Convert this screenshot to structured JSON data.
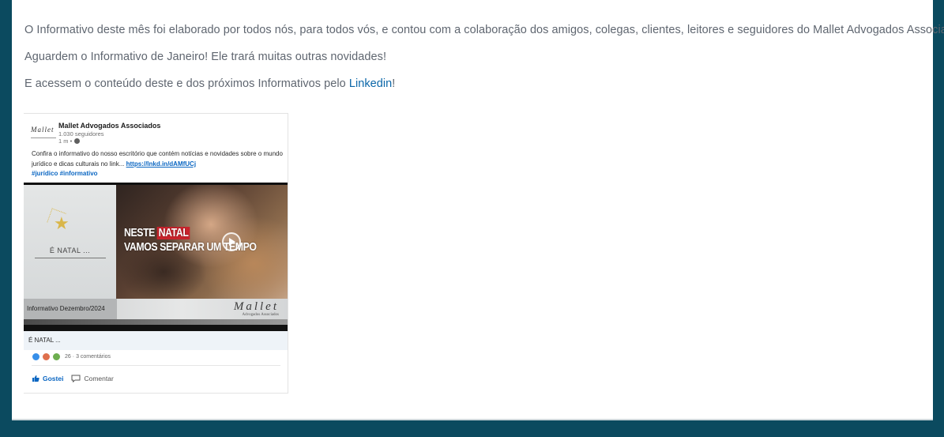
{
  "newsletter": {
    "paragraph_1": "O Informativo deste mês foi elaborado por todos nós, para todos vós, e contou com a colaboração dos amigos, colegas, clientes, leitores e seguidores do Mallet Advogados Associados!",
    "paragraph_2": "Aguardem o Informativo de Janeiro! Ele trará muitas outras novidades!",
    "paragraph_3_prefix": "E acessem o conteúdo deste e dos próximos Informativos pelo ",
    "paragraph_3_link": "Linkedin",
    "paragraph_3_suffix": "!"
  },
  "post": {
    "company_logo_text": "Mallet",
    "company_name": "Mallet Advogados Associados",
    "followers": "1.030 seguidores",
    "time": "1 m •",
    "text": "Confira o informativo do nosso escritório que contém notícias e novidades sobre o mundo jurídico e dicas culturais no link...",
    "link": "https://lnkd.in/dAMfUCj",
    "hashtags": "#jurídico #informativo",
    "media": {
      "left_title": "É NATAL ...",
      "headline_word_1": "NESTE",
      "headline_word_2": "NATAL",
      "headline_line_2": "VAMOS SEPARAR UM TEMPO",
      "bottom_label": "Informativo Dezembro/2024",
      "brand": "Mallet",
      "brand_sub": "Advogados Associados"
    },
    "caption": "É NATAL ...",
    "reactions_count": "26",
    "comments": "· 3 comentários",
    "like_label": "Gostei",
    "comment_label": "Comentar"
  },
  "colors": {
    "page_background": "#0b4a5f",
    "link": "#0a66a8",
    "linkedin_blue": "#0a66c2",
    "headline_red": "#c8232c"
  }
}
